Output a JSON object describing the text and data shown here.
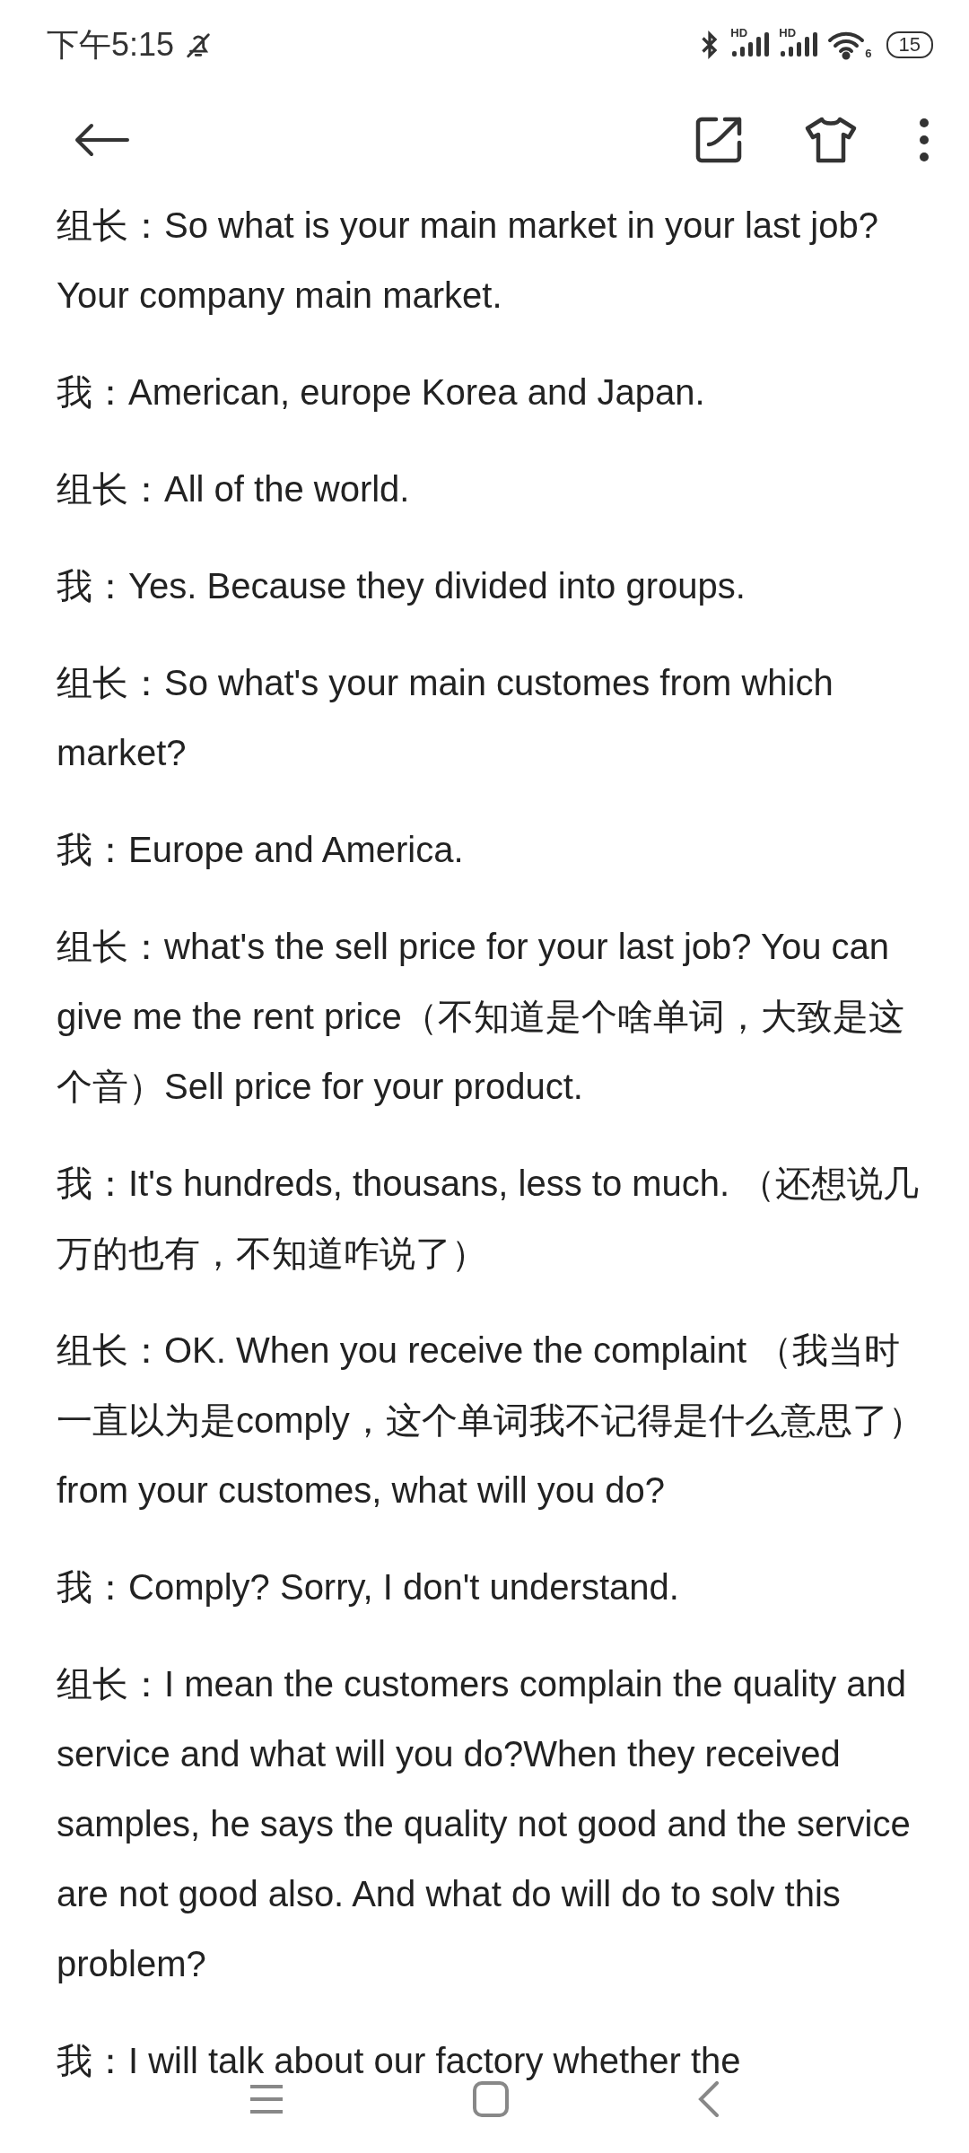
{
  "status_bar": {
    "time": "下午5:15",
    "signal_labels": [
      "HD",
      "HD"
    ],
    "wifi_label": "6",
    "battery": "15"
  },
  "paragraphs": [
    "组长：So what is your main market in your last job? Your company main market.",
    "我：American, europe Korea and Japan.",
    "组长：All of the world.",
    "我：Yes. Because they divided into groups.",
    "组长：So what's your main customes from which market?",
    "我：Europe and America.",
    "组长：what's the sell price for your last job? You can give me the rent price（不知道是个啥单词，大致是这个音）Sell price for your product.",
    "我：It's hundreds, thousans, less to much. （还想说几万的也有，不知道咋说了）",
    "组长：OK. When you receive the complaint （我当时一直以为是comply，这个单词我不记得是什么意思了）from your customes, what will you do?",
    "我：Comply? Sorry, I don't understand.",
    "组长：I mean the customers complain the quality and service and what will you do?When they received samples, he says the quality not good and the service are not good also. And what do will do to solv this problem?",
    "我：I will talk about our factory whether the"
  ]
}
